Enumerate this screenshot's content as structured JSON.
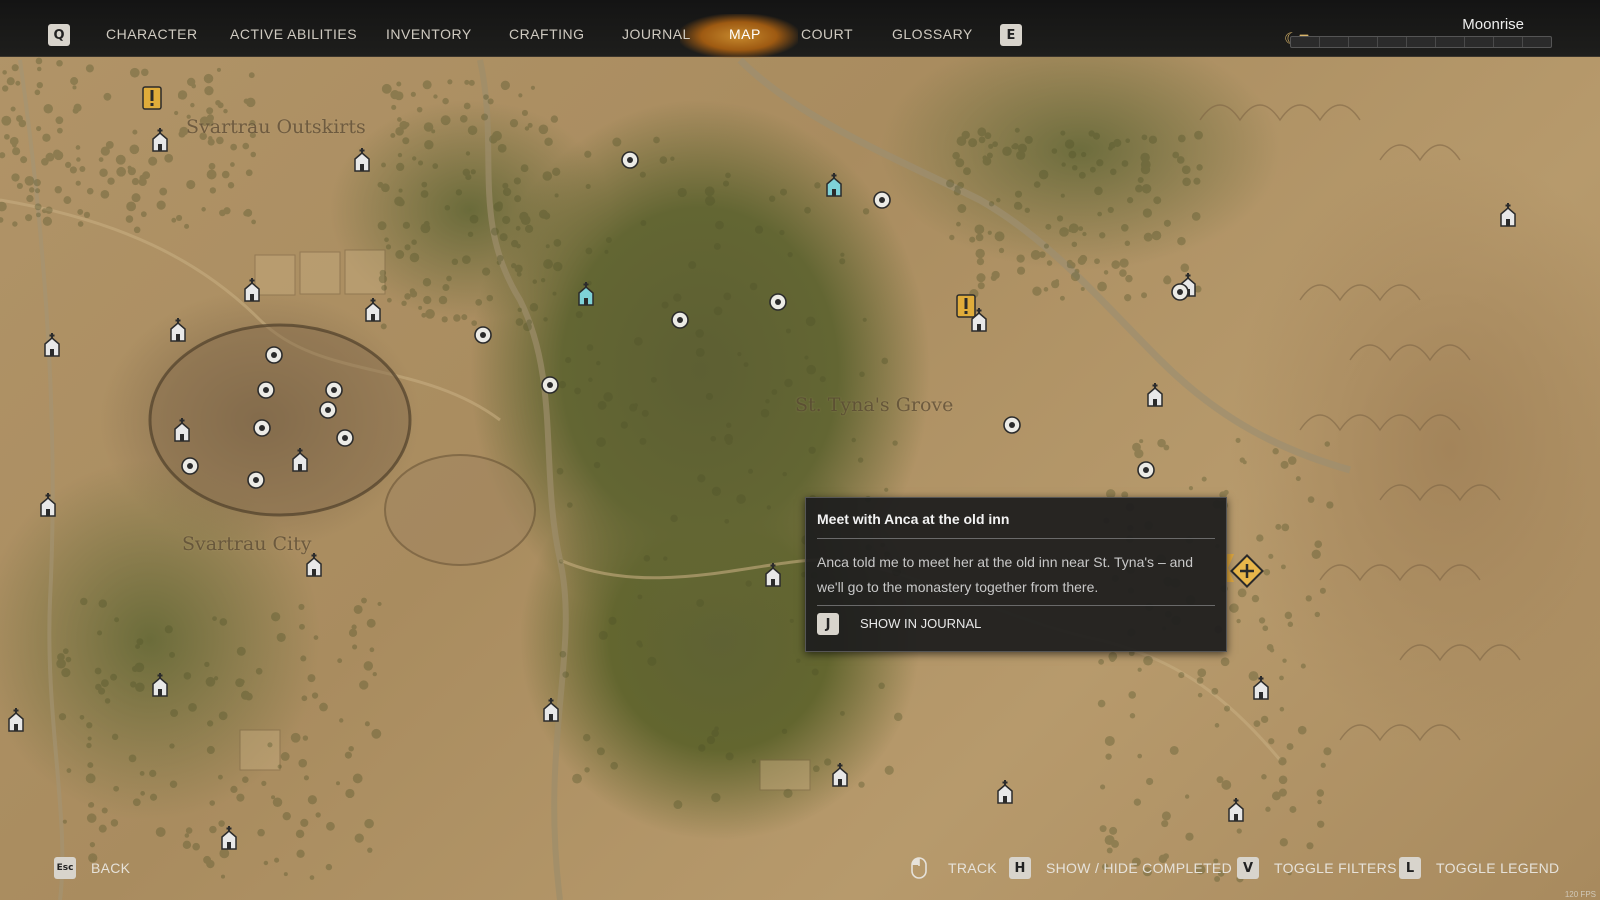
{
  "top_nav": {
    "left_key": "Q",
    "right_key": "E",
    "tabs": [
      "CHARACTER",
      "ACTIVE ABILITIES",
      "INVENTORY",
      "CRAFTING",
      "JOURNAL",
      "MAP",
      "COURT",
      "GLOSSARY"
    ],
    "active_tab": "MAP"
  },
  "time": {
    "label": "Moonrise"
  },
  "map": {
    "regions": [
      "Svartrau Outskirts",
      "St. Tyna's Grove",
      "Svartrau City"
    ]
  },
  "tooltip": {
    "title": "Meet with Anca at the old inn",
    "body": "Anca told me to meet her at the old inn near St. Tyna's – and we'll go to the monastery together from there.",
    "action_key": "J",
    "action_label": "SHOW IN JOURNAL"
  },
  "bottom_bar": {
    "back_key": "Esc",
    "back_label": "BACK",
    "track_label": "TRACK",
    "show_hide_key": "H",
    "show_hide_label": "SHOW / HIDE COMPLETED",
    "filters_key": "V",
    "filters_label": "TOGGLE FILTERS",
    "legend_key": "L",
    "legend_label": "TOGGLE LEGEND"
  },
  "fps_counter": "120 FPS",
  "colors": {
    "accent": "#d9a23b",
    "tooltip_bg": "#1e1e1e",
    "map_base": "#b19468",
    "forest": "#63662f"
  }
}
